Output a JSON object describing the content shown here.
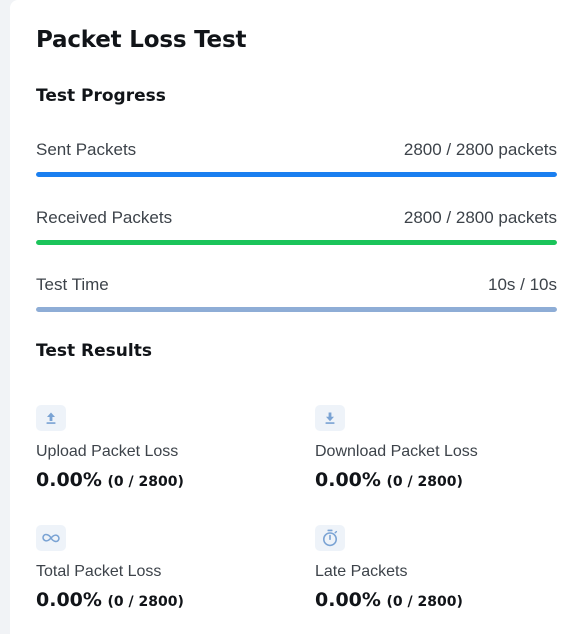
{
  "title": "Packet Loss Test",
  "progress": {
    "heading": "Test Progress",
    "items": [
      {
        "label": "Sent Packets",
        "value": "2800 / 2800 packets",
        "fraction": 1.0,
        "color": "#1a7ff0"
      },
      {
        "label": "Received Packets",
        "value": "2800 / 2800 packets",
        "fraction": 1.0,
        "color": "#1bc45a"
      },
      {
        "label": "Test Time",
        "value": "10s / 10s",
        "fraction": 1.0,
        "color": "#8eadd6"
      }
    ]
  },
  "results": {
    "heading": "Test Results",
    "items": [
      {
        "label": "Upload Packet Loss",
        "percent": "0.00%",
        "ratio": "(0 / 2800)",
        "icon": "upload-icon"
      },
      {
        "label": "Download Packet Loss",
        "percent": "0.00%",
        "ratio": "(0 / 2800)",
        "icon": "download-icon"
      },
      {
        "label": "Total Packet Loss",
        "percent": "0.00%",
        "ratio": "(0 / 2800)",
        "icon": "infinity-icon"
      },
      {
        "label": "Late Packets",
        "percent": "0.00%",
        "ratio": "(0 / 2800)",
        "icon": "stopwatch-icon"
      }
    ]
  },
  "colors": {
    "icon": "#7aa3d4",
    "icon_bg": "#eef3f9",
    "track": "#e6eaef"
  }
}
